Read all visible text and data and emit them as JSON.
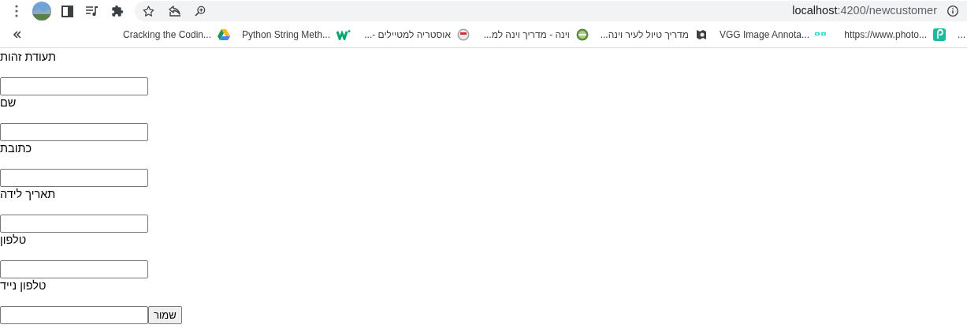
{
  "address_bar": {
    "host": "localhost",
    "path": ":4200/newcustomer"
  },
  "bookmarks_overflow_text": "...",
  "bookmarks": [
    {
      "title": "https://www.photo..."
    },
    {
      "title": "VGG Image Annota..."
    },
    {
      "title": "מדריך טיול לעיר וינה..."
    },
    {
      "title": "וינה - מדריך וינה למ..."
    },
    {
      "title": "אוסטריה למטיילים -..."
    },
    {
      "title": "Python String Meth..."
    },
    {
      "title": "Cracking the Codin..."
    }
  ],
  "form": {
    "fields": [
      {
        "label": "תעודת זהות"
      },
      {
        "label": "שם"
      },
      {
        "label": "כתובת"
      },
      {
        "label": "תאריך לידה"
      },
      {
        "label": "טלפון"
      },
      {
        "label": "טלפון נייד"
      }
    ],
    "submit_button": "שמור"
  }
}
